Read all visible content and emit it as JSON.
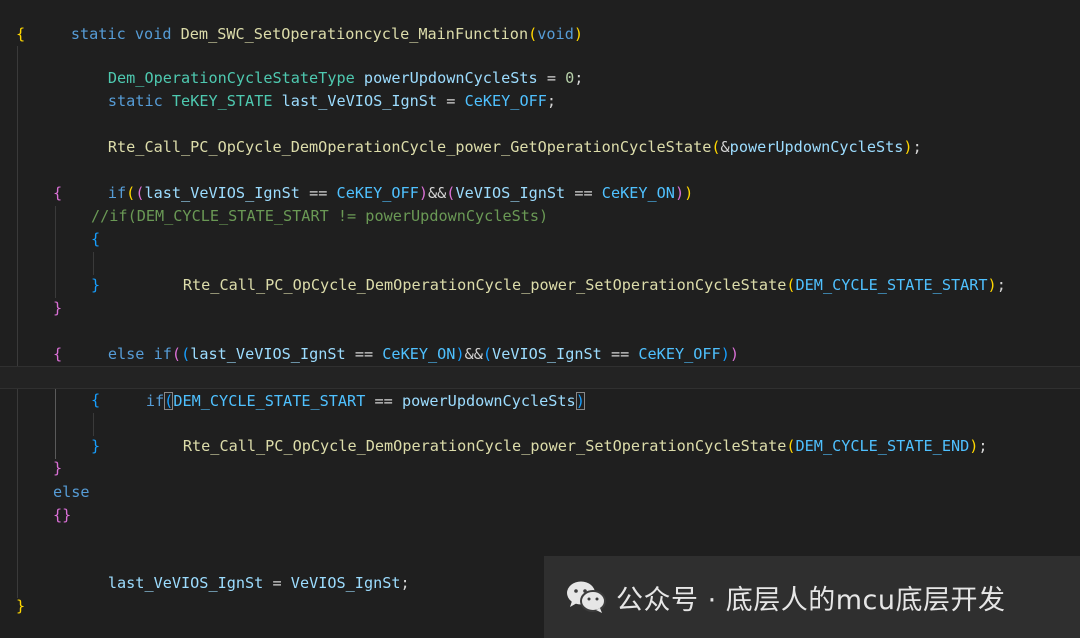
{
  "code": {
    "l1": {
      "kw_static": "static",
      "kw_void": "void",
      "fn_name": "Dem_SWC_SetOperationcycle_MainFunction",
      "open": "(",
      "kw_void2": "void",
      "close": ")"
    },
    "l2": {
      "brace": "{"
    },
    "l3": {
      "type": "Dem_OperationCycleStateType",
      "var": "powerUpdownCycleSts",
      "op": "=",
      "num": "0",
      "semi": ";"
    },
    "l4": {
      "kw_static": "static",
      "type": "TeKEY_STATE",
      "var": "last_VeVIOS_IgnSt",
      "op": "=",
      "cst": "CeKEY_OFF",
      "semi": ";"
    },
    "l5": {
      "fn": "Rte_Call_PC_OpCycle_DemOperationCycle_power_GetOperationCycleState",
      "open": "(",
      "amp": "&",
      "var": "powerUpdownCycleSts",
      "close": ")",
      "semi": ";"
    },
    "l6": {
      "kw_if": "if",
      "open1": "(",
      "open2": "(",
      "var1": "last_VeVIOS_IgnSt",
      "op1": "==",
      "cst1": "CeKEY_OFF",
      "close2": ")",
      "and": "&&",
      "open3": "(",
      "var2": "VeVIOS_IgnSt",
      "op2": "==",
      "cst2": "CeKEY_ON",
      "close3": ")",
      "close1": ")"
    },
    "l7": {
      "brace": "{"
    },
    "l8": {
      "comment": "//if(DEM_CYCLE_STATE_START != powerUpdownCycleSts)"
    },
    "l9": {
      "brace": "{"
    },
    "l10": {
      "fn": "Rte_Call_PC_OpCycle_DemOperationCycle_power_SetOperationCycleState",
      "open": "(",
      "cst": "DEM_CYCLE_STATE_START",
      "close": ")",
      "semi": ";"
    },
    "l11": {
      "brace": "}"
    },
    "l12": {
      "brace": "}"
    },
    "l13": {
      "kw_else": "else",
      "kw_if": "if",
      "open1": "(",
      "open2": "(",
      "var1": "last_VeVIOS_IgnSt",
      "op1": "==",
      "cst1": "CeKEY_ON",
      "close2": ")",
      "and": "&&",
      "open3": "(",
      "var2": "VeVIOS_IgnSt",
      "op2": "==",
      "cst2": "CeKEY_OFF",
      "close3": ")",
      "close1": ")"
    },
    "l14": {
      "brace": "{"
    },
    "l15": {
      "kw_if": "if",
      "open": "(",
      "cst": "DEM_CYCLE_STATE_START",
      "op": "==",
      "var": "powerUpdownCycleSts",
      "close": ")"
    },
    "l16": {
      "brace": "{"
    },
    "l17": {
      "fn": "Rte_Call_PC_OpCycle_DemOperationCycle_power_SetOperationCycleState",
      "open": "(",
      "cst": "DEM_CYCLE_STATE_END",
      "close": ")",
      "semi": ";"
    },
    "l18": {
      "brace": "}"
    },
    "l19": {
      "brace": "}"
    },
    "l20": {
      "kw_else": "else"
    },
    "l21": {
      "braces": "{}"
    },
    "l22": {
      "var1": "last_VeVIOS_IgnSt",
      "op": "=",
      "var2": "VeVIOS_IgnSt",
      "semi": ";"
    },
    "l23": {
      "brace": "}"
    }
  },
  "watermark": {
    "text": "公众号 · 底层人的mcu底层开发",
    "icon": "wechat-icon"
  }
}
